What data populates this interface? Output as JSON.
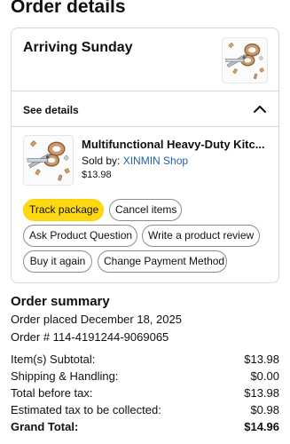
{
  "page": {
    "title": "Order details"
  },
  "shipment": {
    "status": "Arriving Sunday",
    "see_details": "See details"
  },
  "item": {
    "title": "Multifunctional Heavy-Duty Kitc...",
    "sold_by_prefix": "Sold by: ",
    "seller": "XINMIN Shop",
    "price": "$13.98"
  },
  "actions": {
    "track_package": "Track package",
    "cancel_items": "Cancel items",
    "ask_question": "Ask Product Question",
    "write_review": "Write a product review",
    "buy_again": "Buy it again",
    "change_payment": "Change Payment Method"
  },
  "summary": {
    "title": "Order summary",
    "placed": "Order placed December 18, 2025",
    "order_number": "Order # 114-4191244-9069065",
    "rows": [
      {
        "label": "Item(s) Subtotal:",
        "value": "$13.98"
      },
      {
        "label": "Shipping & Handling:",
        "value": "$0.00"
      },
      {
        "label": "Total before tax:",
        "value": "$13.98"
      },
      {
        "label": "Estimated tax to be collected:",
        "value": "$0.98"
      }
    ],
    "grand_total": {
      "label": "Grand Total:",
      "value": "$14.96"
    }
  },
  "colors": {
    "primary_button": "#ffd814",
    "link": "#2162a1",
    "border": "#d5d9d9"
  }
}
